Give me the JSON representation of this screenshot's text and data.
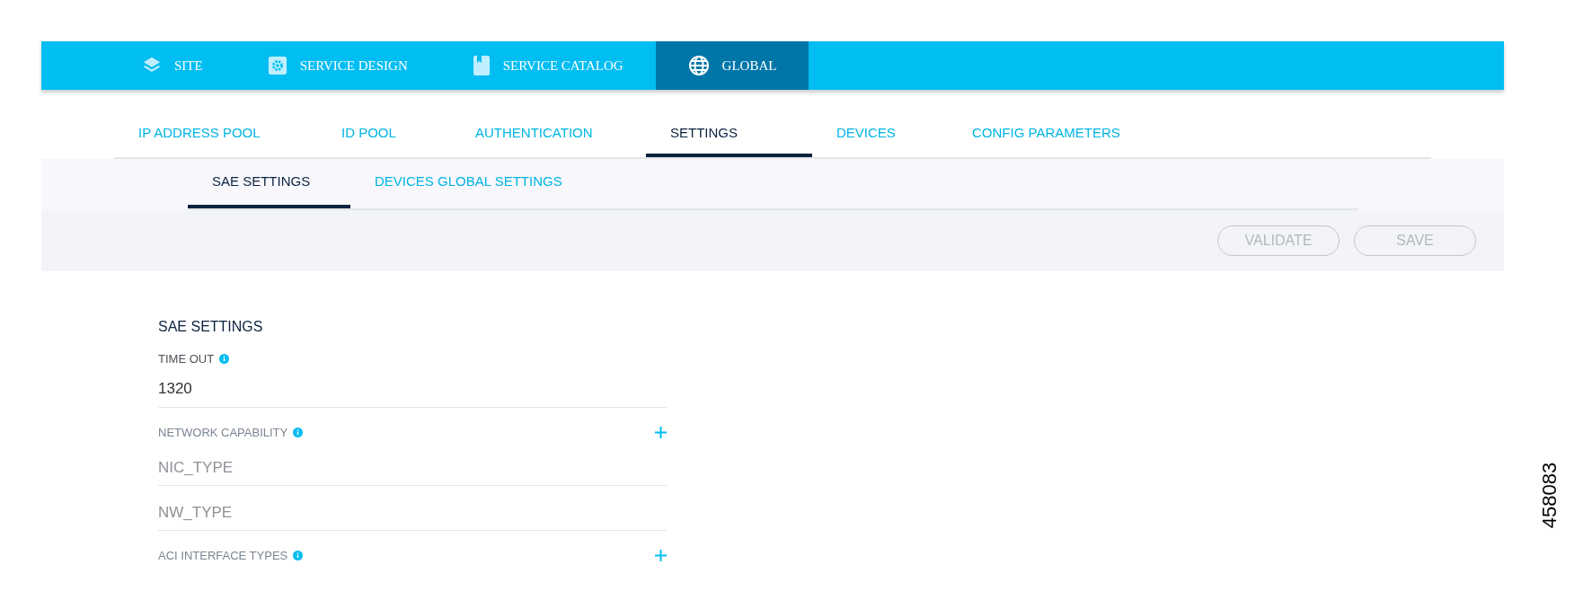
{
  "top_nav": [
    {
      "label": "SITE",
      "selected": false
    },
    {
      "label": "SERVICE DESIGN",
      "selected": false
    },
    {
      "label": "SERVICE CATALOG",
      "selected": false
    },
    {
      "label": "GLOBAL",
      "selected": true
    }
  ],
  "tabs": [
    {
      "label": "IP ADDRESS POOL",
      "selected": false
    },
    {
      "label": "ID POOL",
      "selected": false
    },
    {
      "label": "AUTHENTICATION",
      "selected": false
    },
    {
      "label": "SETTINGS",
      "selected": true
    },
    {
      "label": "DEVICES",
      "selected": false
    },
    {
      "label": "CONFIG PARAMETERS",
      "selected": false
    }
  ],
  "sub_tabs": [
    {
      "label": "SAE SETTINGS",
      "selected": true
    },
    {
      "label": "DEVICES GLOBAL SETTINGS",
      "selected": false
    }
  ],
  "actions": [
    {
      "label": "VALIDATE",
      "disabled": true
    },
    {
      "label": "SAVE",
      "disabled": true
    }
  ],
  "form": {
    "title": "SAE SETTINGS",
    "fields": [
      {
        "kind": "input",
        "label": "TIME OUT",
        "value": "1320"
      },
      {
        "kind": "list",
        "label": "NETWORK CAPABILITY",
        "items": [
          {
            "placeholder": "NIC_TYPE"
          },
          {
            "placeholder": "NW_TYPE"
          }
        ]
      },
      {
        "kind": "list",
        "label": "ACI INTERFACE TYPES"
      }
    ]
  },
  "figure_number": "458083"
}
